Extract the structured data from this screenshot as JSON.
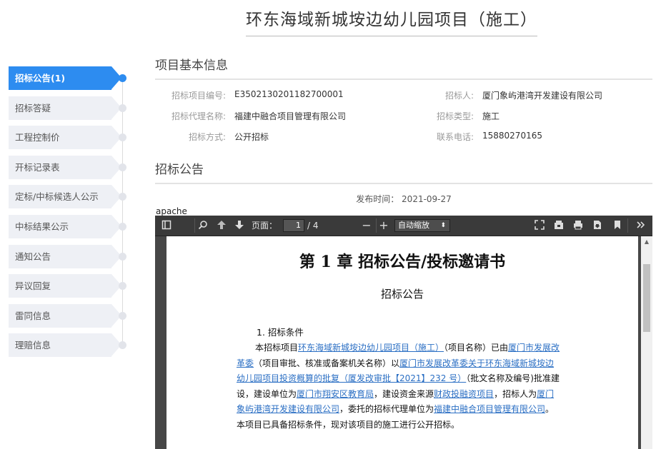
{
  "title": "环东海域新城垵边幼儿园项目（施工）",
  "sidebar": {
    "items": [
      {
        "label": "招标公告(1)",
        "active": true
      },
      {
        "label": "招标答疑",
        "active": false
      },
      {
        "label": "工程控制价",
        "active": false
      },
      {
        "label": "开标记录表",
        "active": false
      },
      {
        "label": "定标/中标候选人公示",
        "active": false
      },
      {
        "label": "中标结果公示",
        "active": false
      },
      {
        "label": "通知公告",
        "active": false
      },
      {
        "label": "异议回复",
        "active": false
      },
      {
        "label": "雷同信息",
        "active": false
      },
      {
        "label": "理赔信息",
        "active": false
      }
    ]
  },
  "basic_info": {
    "section_title": "项目基本信息",
    "project_no_label": "招标项目编号:",
    "project_no": "E3502130201182700001",
    "tenderer_label": "招标人:",
    "tenderer": "厦门象屿港湾开发建设有限公司",
    "agent_label": "招标代理名称:",
    "agent": "福建中融合项目管理有限公司",
    "type_label": "招标类型:",
    "type": "施工",
    "method_label": "招标方式:",
    "method": "公开招标",
    "phone_label": "联系电话:",
    "phone": "15880270165"
  },
  "announcement": {
    "section_title": "招标公告",
    "publish_label": "发布时间：",
    "publish_date": "2021-09-27",
    "embed_label": "apache"
  },
  "viewer": {
    "page_label": "页面：",
    "page_current": "1",
    "page_total": "/ 4",
    "zoom": "自动缩放",
    "zoom_out": "−",
    "zoom_in": "+"
  },
  "pdf": {
    "heading": "第 1 章 招标公告/投标邀请书",
    "subheading": "招标公告",
    "section": "1. 招标条件",
    "body": {
      "t1": "本招标项目",
      "l1": "环东海域新城垵边幼儿园项目（施工）",
      "t2": "（项目名称）已由",
      "l2": "厦门市发展改革委",
      "t3": "（项目审批、核准或备案机关名称）以",
      "l3": "厦门市发展改革委关于环东海域新城垵边幼儿园项目投资概算的批复（厦发改审批【2021】232 号）",
      "t4": "（批文名称及编号)批准建设，建设单位为",
      "l4": "厦门市翔安区教育局",
      "t5": "，建设资金来源",
      "l5": "财政投融资项目",
      "t6": "，招标人为",
      "l6": "厦门象屿港湾开发建设有限公司",
      "t7": "，委托的招标代理单位为",
      "l7": "福建中融合项目管理有限公司",
      "t8": "。本项目已具备招标条件，现对该项目的施工进行公开招标。"
    }
  },
  "colors": {
    "accent": "#2d8cf0",
    "nav_bg": "#eef0f5",
    "toolbar_bg": "#3a3a3a",
    "link": "#2b6fc4"
  }
}
